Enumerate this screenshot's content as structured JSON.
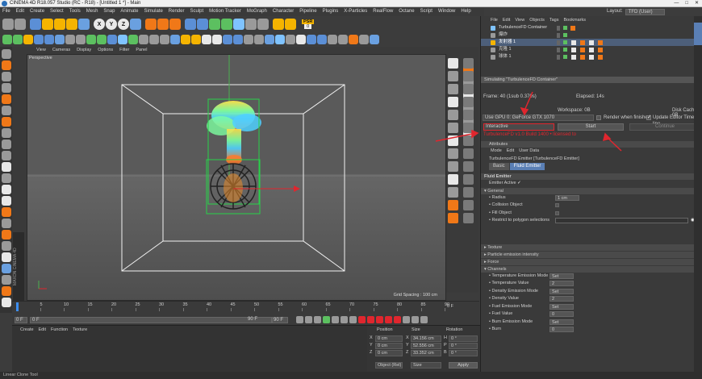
{
  "window": {
    "title": "CINEMA 4D R18.057 Studio (RC - R18) - [Untitled 1 *] - Main",
    "controls": [
      "—",
      "□",
      "✕"
    ]
  },
  "menubar": [
    "File",
    "Edit",
    "Create",
    "Select",
    "Tools",
    "Mesh",
    "Snap",
    "Animate",
    "Simulate",
    "Render",
    "Sculpt",
    "Motion Tracker",
    "MoGraph",
    "Character",
    "Pipeline",
    "Plugins",
    "X-Particles",
    "RealFlow",
    "Octane",
    "Script",
    "Window",
    "Help"
  ],
  "layout": {
    "label": "Layout:",
    "value": "TFD (User)"
  },
  "toolbar1_icons": [
    "undo-icon",
    "redo-icon",
    "select-live-icon",
    "move-icon",
    "scale-icon",
    "rotate-icon",
    "recent-icon",
    "x-axis-icon",
    "y-axis-icon",
    "z-axis-icon",
    "coord-system-icon",
    "render-view-icon",
    "render-pic-icon",
    "render-settings-icon",
    "cube-icon",
    "pen-icon",
    "subdivision-icon",
    "array-icon",
    "deformer-icon",
    "floor-icon",
    "camera-icon",
    "light-icon",
    "psr-icon"
  ],
  "toolbar1_letters": [
    "X",
    "Y",
    "Z"
  ],
  "psr": {
    "label": "PSR",
    "value": "0"
  },
  "viewport": {
    "menu": [
      "View",
      "Cameras",
      "Display",
      "Options",
      "Filter",
      "Panel"
    ],
    "label": "Perspective",
    "grid_spacing": "Grid Spacing : 100 cm"
  },
  "timeline": {
    "ticks": [
      "0",
      "5",
      "10",
      "15",
      "20",
      "25",
      "30",
      "35",
      "40",
      "45",
      "50",
      "55",
      "60",
      "65",
      "70",
      "75",
      "80",
      "85",
      "90"
    ],
    "start": "0 F",
    "current": "0 F",
    "end": "90 F",
    "end2": "90 F",
    "current_frame": "0 F"
  },
  "material_manager": {
    "menu": [
      "Create",
      "Edit",
      "Function",
      "Texture"
    ]
  },
  "coordinates": {
    "headers": [
      "Position",
      "Size",
      "Rotation"
    ],
    "rows": [
      {
        "axis": "X",
        "pos": "0 cm",
        "size_axis": "X",
        "size": "34.156 cm",
        "rot_axis": "H",
        "rot": "0 °"
      },
      {
        "axis": "Y",
        "pos": "0 cm",
        "size_axis": "Y",
        "size": "52.556 cm",
        "rot_axis": "P",
        "rot": "0 °"
      },
      {
        "axis": "Z",
        "pos": "0 cm",
        "size_axis": "Z",
        "size": "33.352 cm",
        "rot_axis": "B",
        "rot": "0 °"
      }
    ],
    "mode1": "Object (Rel)",
    "mode2": "Size",
    "apply": "Apply"
  },
  "status": "Linear Clone Tool",
  "object_manager": {
    "menu": [
      "File",
      "Edit",
      "View",
      "Objects",
      "Tags",
      "Bookmarks"
    ],
    "objects": [
      {
        "name": "TurbulenceFD Container",
        "selected": false
      },
      {
        "name": "爆炸",
        "selected": false
      },
      {
        "name": "发射器 1",
        "selected": true
      },
      {
        "name": "克隆 1",
        "selected": false
      },
      {
        "name": "球体 1",
        "selected": false
      }
    ]
  },
  "simulation": {
    "header": "Simulating \"TurbulenceFD Container\"",
    "frame": "Frame: 40 (1sub 0.370s)",
    "elapsed": "Elapsed: 14s",
    "workspace": "Workspace: 0B",
    "disk_cache": "Disk Cache: 0B",
    "gpu": "Use GPU 0: GeForce GTX 1070",
    "render_when_finished": "Render when finished",
    "update_editor": "Update Editor Time-line",
    "mode": "Interactive",
    "start": "Start",
    "continue": "Continue",
    "license": "TurbulenceFD v1.0 Build 1400 • licensed to"
  },
  "attributes": {
    "title": "Attributes",
    "menu": [
      "Mode",
      "Edit",
      "User Data"
    ],
    "object": "TurbulenceFD Emitter [TurbulenceFD Emitter]",
    "tabs": [
      "Basic",
      "Fluid Emitter"
    ],
    "section": "Fluid Emitter",
    "emitter_active": "Emitter Active",
    "general": "General",
    "radius_label": "Radius",
    "radius_value": "1 cm",
    "collision": "Collision Object",
    "fill": "Fill Object",
    "restrict": "Restrict to polygon selections",
    "collapsed": [
      "Texture",
      "Particle emission intensity",
      "Force"
    ],
    "channels": "Channels",
    "channel_rows": [
      {
        "label": "Temperature Emission Mode",
        "value": "Set"
      },
      {
        "label": "Temperature Value",
        "value": "2"
      },
      {
        "label": "Density Emission Mode",
        "value": "Set"
      },
      {
        "label": "Density Value",
        "value": "2"
      },
      {
        "label": "Fuel Emission Mode",
        "value": "Set"
      },
      {
        "label": "Fuel Value",
        "value": "0"
      },
      {
        "label": "Burn Emission Mode",
        "value": "Set"
      },
      {
        "label": "Burn",
        "value": "0"
      }
    ]
  },
  "colors": {
    "accent": "#e0262e",
    "selection": "#5a7fb5",
    "yellow": "#f5b400",
    "orange": "#f07818"
  }
}
